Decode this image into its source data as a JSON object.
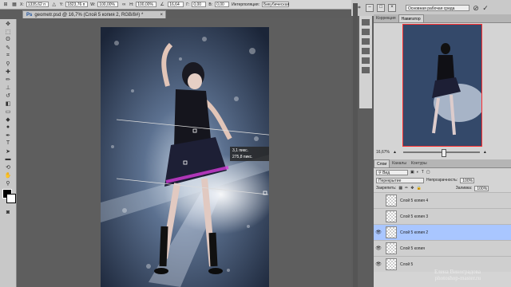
{
  "options_bar": {
    "x_label": "X:",
    "x_value": "1335,62 п",
    "y_label": "Y:",
    "y_value": "1823,76 п",
    "w_label": "W:",
    "w_value": "100,00%",
    "h_label": "H:",
    "h_value": "100,00%",
    "angle_value": "16,64",
    "hskew_label": "Г:",
    "hskew_value": "0,00",
    "vskew_label": "В:",
    "vskew_value": "0,00",
    "interp_label": "Интерполяция:",
    "interp_value": "Бикубическая"
  },
  "topright": {
    "workspace": "Основная рабочая среда"
  },
  "document": {
    "tab_title": "geometr.psd @ 16,7% (Слой 5 копия 2, RGB/8#) *"
  },
  "transform_hud": {
    "line1": "3,1 пикс.",
    "line2": "275,8 пикс."
  },
  "navigator": {
    "tab_correction": "Коррекция",
    "tab_navigator": "Навигатор",
    "zoom": "16,67%"
  },
  "layers": {
    "tab_layers": "Слои",
    "tab_channels": "Каналы",
    "tab_paths": "Контуры",
    "kind": "Вид",
    "blend_mode": "Перекрытие",
    "opacity_label": "Непрозрачность:",
    "opacity_value": "100%",
    "lock_label": "Закрепить:",
    "fill_label": "Заливка:",
    "fill_value": "100%",
    "items": [
      {
        "name": "Слой 5 копия 4",
        "visible": false,
        "active": false
      },
      {
        "name": "Слой 5 копия 3",
        "visible": false,
        "active": false
      },
      {
        "name": "Слой 5 копия 2",
        "visible": true,
        "active": true
      },
      {
        "name": "Слой 5 копия",
        "visible": true,
        "active": false
      },
      {
        "name": "Слой 5",
        "visible": true,
        "active": false
      }
    ]
  },
  "watermark": {
    "line1": "Елена Виноградова",
    "line2": "photoshop-master.ru"
  }
}
